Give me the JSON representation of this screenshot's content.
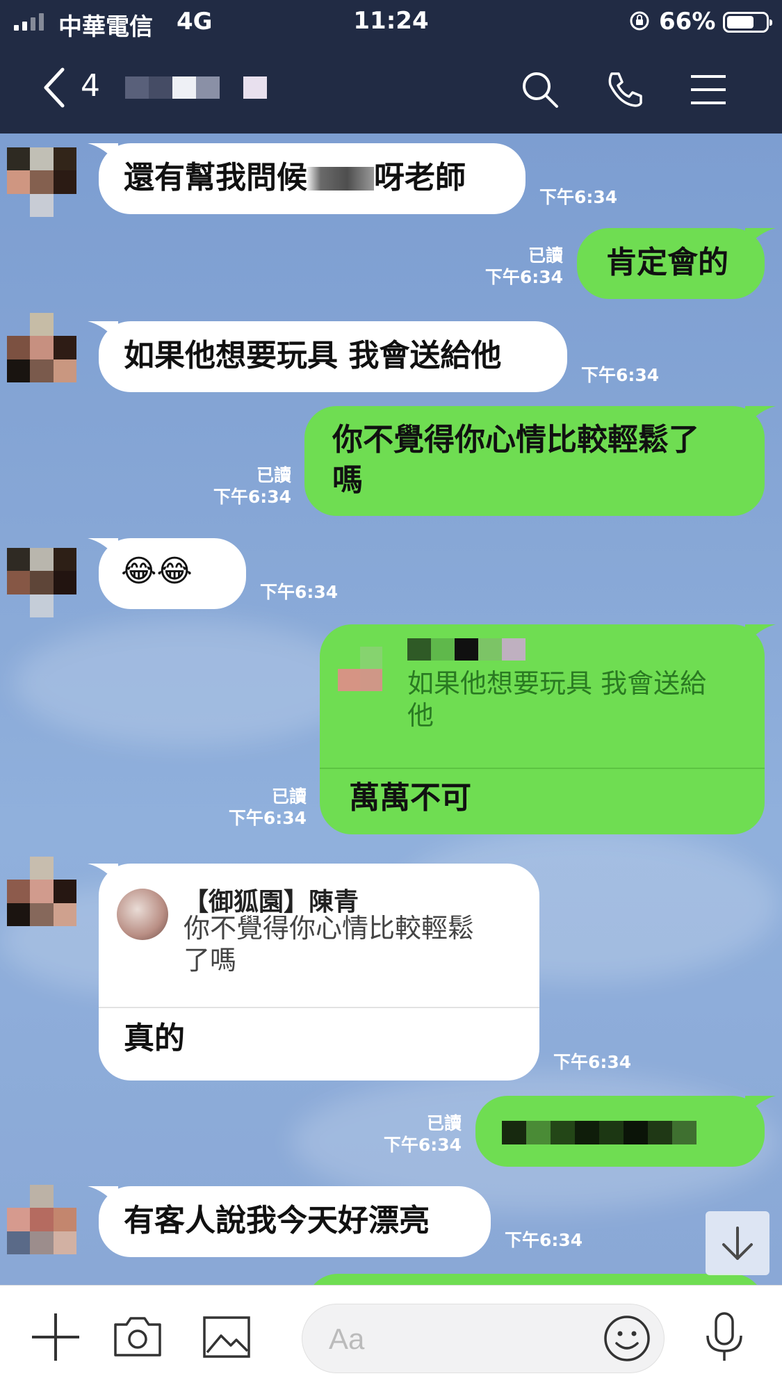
{
  "status_bar": {
    "carrier": "中華電信",
    "network": "4G",
    "time": "11:24",
    "battery": "66%",
    "battery_level": 0.66
  },
  "header": {
    "unread_count": "4"
  },
  "messages": [
    {
      "side": "in",
      "text_before": "還有幫我問候",
      "text_after": "呀老師",
      "time": "下午6:34"
    },
    {
      "side": "out",
      "text": "肯定會的",
      "read": "已讀",
      "time": "下午6:34"
    },
    {
      "side": "in",
      "text": "如果他想要玩具 我會送給他",
      "time": "下午6:34"
    },
    {
      "side": "out",
      "text_line1": "你不覺得你心情比較輕鬆了",
      "text_line2": "嗎",
      "read": "已讀",
      "time": "下午6:34"
    },
    {
      "side": "in",
      "text": "😂😂",
      "time": "下午6:34"
    },
    {
      "side": "out",
      "quote_line1": "如果他想要玩具 我會送給",
      "quote_line2": "他",
      "text": "萬萬不可",
      "read": "已讀",
      "time": "下午6:34"
    },
    {
      "side": "in",
      "quote_name": "【御狐園】陳青",
      "quote_line1": "你不覺得你心情比較輕鬆",
      "quote_line2": "了嗎",
      "text": "真的",
      "time": "下午6:34"
    },
    {
      "side": "out",
      "read": "已讀",
      "time": "下午6:34"
    },
    {
      "side": "in",
      "text": "有客人說我今天好漂亮",
      "time": "下午6:34"
    }
  ],
  "input": {
    "placeholder": "Aa"
  },
  "icons": {
    "back": "chevron-left-icon",
    "search": "search-icon",
    "call": "phone-icon",
    "menu": "menu-icon",
    "add": "plus-icon",
    "camera": "camera-icon",
    "image": "image-icon",
    "emoji": "emoji-icon",
    "mic": "microphone-icon",
    "scroll": "arrow-down-icon"
  },
  "colors": {
    "header_bg": "#212b44",
    "bubble_out": "#6fdd52",
    "bubble_in": "#ffffff"
  }
}
